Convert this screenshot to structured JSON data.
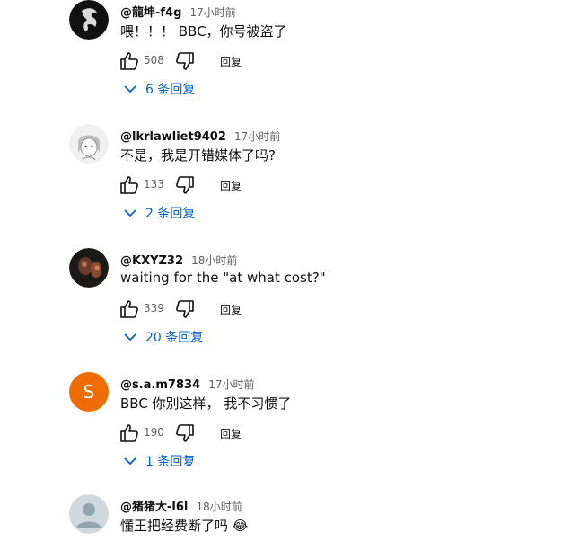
{
  "colors": {
    "accent": "#065fd4",
    "muted": "#606060",
    "text": "#0f0f0f",
    "s_avatar": "#ef6c00"
  },
  "comments": [
    {
      "author": "@龍坤-f4g",
      "time": "17小时前",
      "text": "喂！！！ BBC，你号被盗了",
      "likes": "508",
      "reply_label": "回复",
      "replies": "6 条回复",
      "avatar_icon": "dragon-avatar"
    },
    {
      "author": "@lkrlawliet9402",
      "time": "17小时前",
      "text": "不是，我是开错媒体了吗?",
      "likes": "133",
      "reply_label": "回复",
      "replies": "2 条回复",
      "avatar_icon": "anime-character-avatar"
    },
    {
      "author": "@KXYZ32",
      "time": "18小时前",
      "text": "waiting for the \"at what cost?\"",
      "likes": "339",
      "reply_label": "回复",
      "replies": "20 条回复",
      "avatar_icon": "dark-photo-avatar"
    },
    {
      "author": "@s.a.m7834",
      "time": "17小时前",
      "text": "BBC 你别这样， 我不习惯了",
      "likes": "190",
      "reply_label": "回复",
      "replies": "1 条回复",
      "avatar_letter": "S"
    },
    {
      "author": "@猪猪大-l6l",
      "time": "18小时前",
      "text": "懂王把经费断了吗 😂",
      "avatar_icon": "default-user-avatar"
    }
  ]
}
